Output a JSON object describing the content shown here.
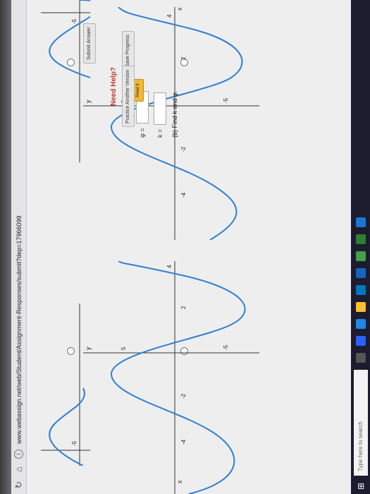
{
  "browser": {
    "url": "www.webassign.net/web/Student/Assignment-Responses/submit?dep=17966099",
    "refresh_icon": "refresh-icon",
    "home_icon": "home-icon"
  },
  "graph_labels": {
    "y": "y",
    "x": "x",
    "neg5": "-5",
    "pos5": "5",
    "neg4": "-4",
    "neg2": "-2",
    "pos2": "2",
    "pos4": "4"
  },
  "part_b": {
    "prompt": "(b) Find k and φ.",
    "k_label": "k =",
    "phi_label": "φ ="
  },
  "help": {
    "need_help": "Need Help?",
    "read_it": "Read It"
  },
  "actions": {
    "submit": "Submit Answer",
    "save": "Save Progress",
    "practice": "Practice Another Version"
  },
  "taskbar": {
    "search_placeholder": "Type here to search"
  },
  "colors": {
    "curve": "#2f7fd0",
    "need_help": "#c0392b",
    "read_it": "#f2b632"
  }
}
